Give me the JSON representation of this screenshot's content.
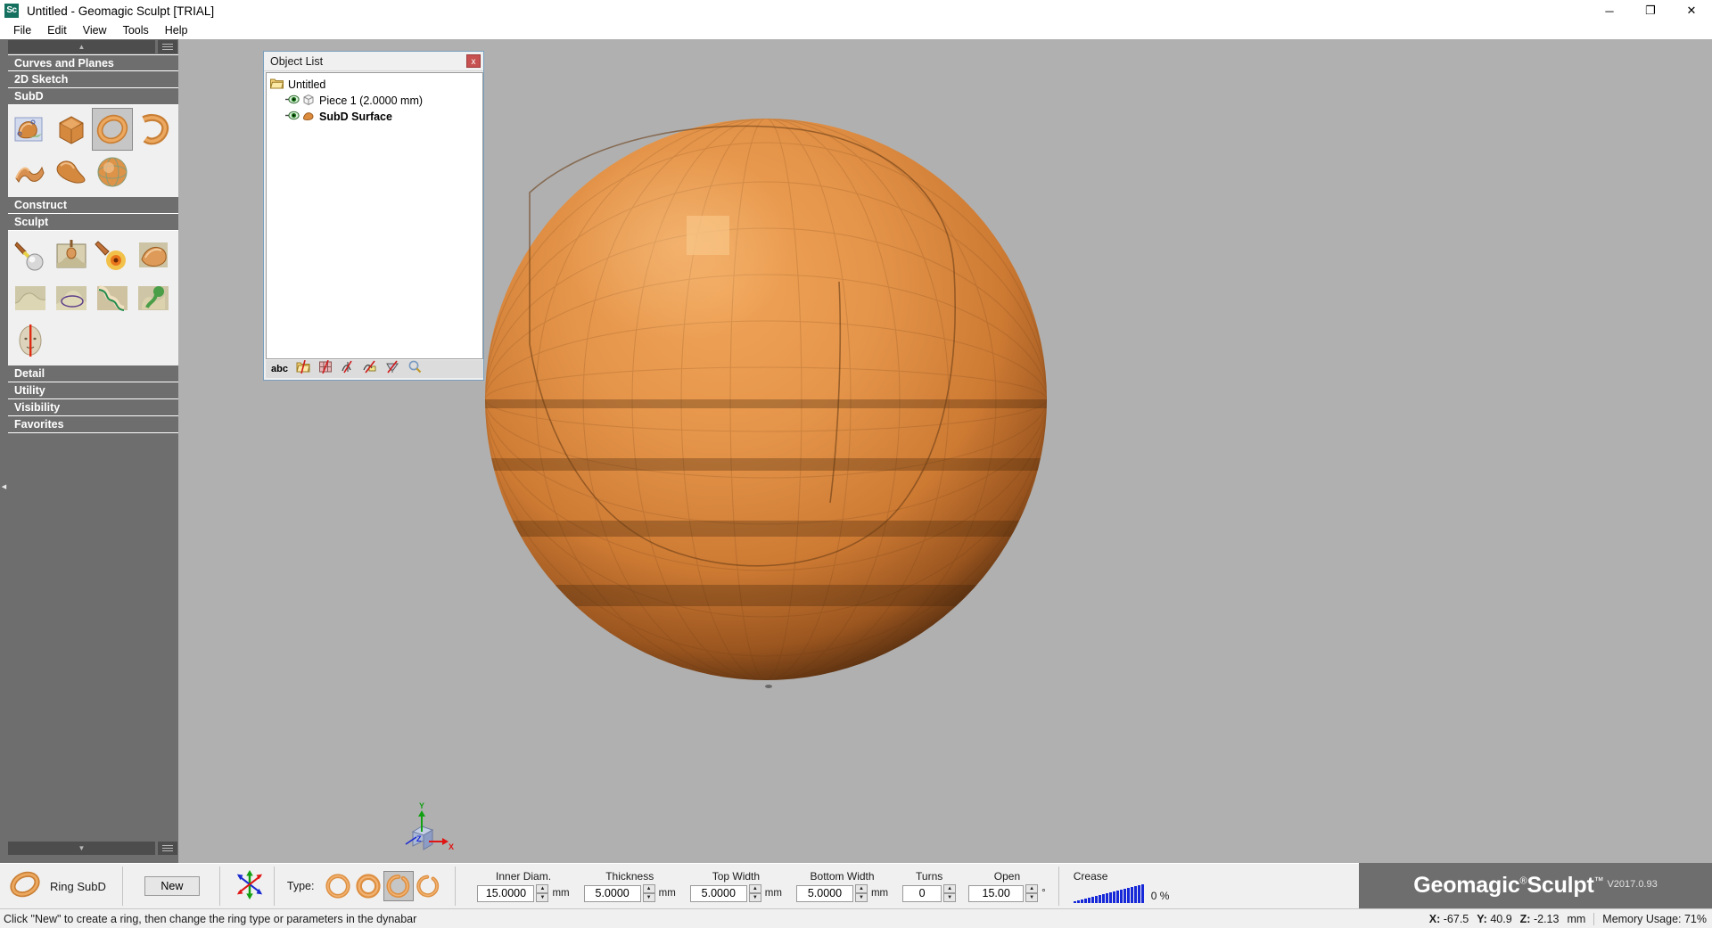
{
  "window": {
    "app_icon_text": "Sc",
    "title": "Untitled - Geomagic Sculpt [TRIAL]",
    "minimize": "─",
    "maximize": "❐",
    "close": "✕"
  },
  "menubar": {
    "items": [
      "File",
      "Edit",
      "View",
      "Tools",
      "Help"
    ]
  },
  "left_panel": {
    "scroll_up_arrow": "▲",
    "scroll_down_arrow": "▼",
    "collapse_arrow": "◀",
    "sections": [
      {
        "label": "Curves and Planes",
        "expanded": false
      },
      {
        "label": "2D Sketch",
        "expanded": false
      },
      {
        "label": "SubD",
        "expanded": true
      },
      {
        "label": "Construct",
        "expanded": false
      },
      {
        "label": "Sculpt",
        "expanded": true
      },
      {
        "label": "Detail",
        "expanded": false
      },
      {
        "label": "Utility",
        "expanded": false
      },
      {
        "label": "Visibility",
        "expanded": false
      },
      {
        "label": "Favorites",
        "expanded": false
      }
    ],
    "subd_tools": [
      {
        "name": "tube-subd",
        "selected": false
      },
      {
        "name": "box-subd",
        "selected": false
      },
      {
        "name": "ring-subd",
        "selected": true
      },
      {
        "name": "band-subd",
        "selected": false
      },
      {
        "name": "sheet-subd",
        "selected": false
      },
      {
        "name": "teardrop-subd",
        "selected": false
      },
      {
        "name": "sphere-subd",
        "selected": false
      }
    ],
    "sculpt_tools": [
      {
        "name": "clay-tool",
        "selected": false
      },
      {
        "name": "emboss-tool",
        "selected": false
      },
      {
        "name": "smudge-tool",
        "selected": false
      },
      {
        "name": "paint-tool",
        "selected": false
      },
      {
        "name": "smooth-tool",
        "selected": false
      },
      {
        "name": "tug-tool",
        "selected": false
      },
      {
        "name": "sweep-tool",
        "selected": false
      },
      {
        "name": "deform-tool",
        "selected": false
      },
      {
        "name": "symmetry-tool",
        "selected": false
      }
    ]
  },
  "object_list": {
    "title": "Object List",
    "close_label": "x",
    "tree": [
      {
        "label": "Untitled",
        "icon": "folder-icon",
        "bold": false,
        "indent": 0,
        "has_eye": false
      },
      {
        "label": "Piece 1 (2.0000 mm)",
        "icon": "piece-icon",
        "bold": false,
        "indent": 1,
        "has_eye": true
      },
      {
        "label": "SubD Surface",
        "icon": "subd-surface-icon",
        "bold": true,
        "indent": 1,
        "has_eye": true
      }
    ],
    "toolbar": [
      {
        "name": "abc-label",
        "label": "abc"
      },
      {
        "name": "hide-folders-icon",
        "label": ""
      },
      {
        "name": "hide-grid-icon",
        "label": ""
      },
      {
        "name": "hide-curves-icon",
        "label": ""
      },
      {
        "name": "hide-planes-icon",
        "label": ""
      },
      {
        "name": "hide-sketch-icon",
        "label": ""
      },
      {
        "name": "zoom-to-fit-icon",
        "label": ""
      }
    ]
  },
  "viewport": {
    "axis_gizmo": {
      "x_label": "X",
      "y_label": "Y",
      "z_label": "Z"
    }
  },
  "dynabar": {
    "tool_name": "Ring SubD",
    "new_button": "New",
    "type_label": "Type:",
    "type_options": [
      {
        "name": "full-ring-thin",
        "selected": false
      },
      {
        "name": "full-ring-thick",
        "selected": false
      },
      {
        "name": "open-ring-wide",
        "selected": true
      },
      {
        "name": "open-ring-narrow",
        "selected": false
      }
    ],
    "fields": [
      {
        "name": "inner-diameter",
        "caption": "Inner Diam.",
        "value": "15.0000",
        "unit": "mm"
      },
      {
        "name": "thickness",
        "caption": "Thickness",
        "value": "5.0000",
        "unit": "mm"
      },
      {
        "name": "top-width",
        "caption": "Top Width",
        "value": "5.0000",
        "unit": "mm"
      },
      {
        "name": "bottom-width",
        "caption": "Bottom Width",
        "value": "5.0000",
        "unit": "mm"
      },
      {
        "name": "turns",
        "caption": "Turns",
        "value": "0",
        "unit": ""
      },
      {
        "name": "open-angle",
        "caption": "Open",
        "value": "15.00",
        "unit": "°"
      }
    ],
    "spin_up": "▲",
    "spin_down": "▼",
    "crease": {
      "caption": "Crease",
      "value": "0 %"
    }
  },
  "brand": {
    "name_part1": "Geomagic",
    "registered": "®",
    "name_part2": "Sculpt",
    "trademark": "™",
    "version": "V2017.0.93"
  },
  "statusbar": {
    "hint": "Click \"New\" to create a ring, then change the ring type or parameters in the dynabar",
    "x_label": "X:",
    "x_value": "-67.5",
    "y_label": "Y:",
    "y_value": "40.9",
    "z_label": "Z:",
    "z_value": "-2.13",
    "unit": "mm",
    "memory": "Memory Usage: 71%"
  },
  "colors": {
    "panel_gray": "#6e6e6e",
    "viewport_bg": "#b0b0b0",
    "model_orange": "#e08a3c",
    "accent_blue": "#1628d8"
  }
}
